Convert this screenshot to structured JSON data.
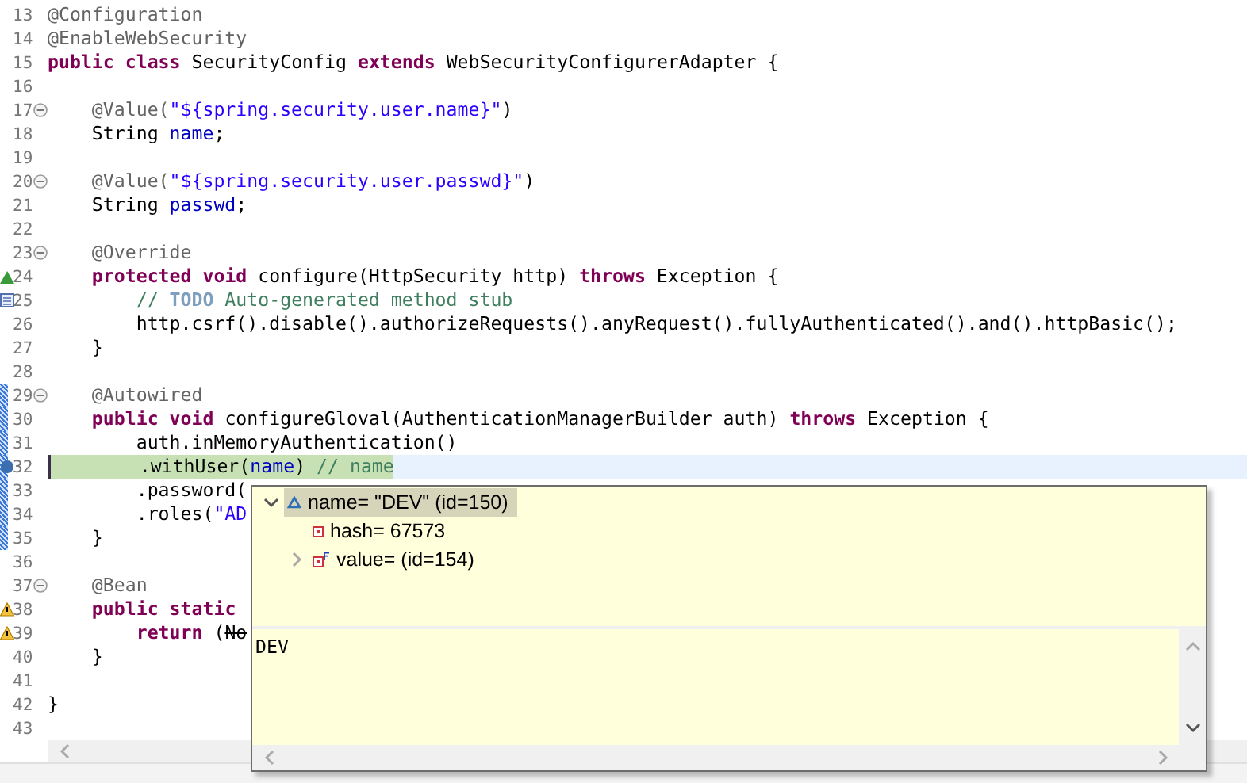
{
  "editor": {
    "lines": [
      {
        "number": "13",
        "kind": "plain",
        "fold": false,
        "in_frame": false,
        "current": false,
        "tokens": [
          {
            "kind": "annotation",
            "text": "@Configuration"
          }
        ]
      },
      {
        "number": "14",
        "kind": "plain",
        "fold": false,
        "in_frame": false,
        "current": false,
        "tokens": [
          {
            "kind": "annotation",
            "text": "@EnableWebSecurity"
          }
        ]
      },
      {
        "number": "15",
        "kind": "plain",
        "fold": false,
        "in_frame": false,
        "current": false,
        "tokens": [
          {
            "kind": "keyword",
            "text": "public"
          },
          {
            "kind": "keyword",
            "text": " class"
          },
          {
            "kind": "plain",
            "text": " SecurityConfig "
          },
          {
            "kind": "keyword",
            "text": "extends"
          },
          {
            "kind": "plain",
            "text": " WebSecurityConfigurerAdapter {"
          }
        ]
      },
      {
        "number": "16",
        "kind": "plain",
        "fold": false,
        "in_frame": false,
        "current": false
      },
      {
        "number": "17",
        "kind": "plain",
        "fold": true,
        "in_frame": false,
        "current": false,
        "tokens": [
          {
            "kind": "annotation",
            "text": "    @Value("
          },
          {
            "kind": "string",
            "text": "\"${spring.security.user.name}\""
          },
          {
            "kind": "plain",
            "text": ")"
          }
        ]
      },
      {
        "number": "18",
        "kind": "plain",
        "fold": false,
        "in_frame": false,
        "current": false,
        "tokens": [
          {
            "kind": "plain",
            "text": "    String "
          },
          {
            "kind": "field",
            "text": "name"
          },
          {
            "kind": "plain",
            "text": ";"
          }
        ]
      },
      {
        "number": "19",
        "kind": "plain",
        "fold": false,
        "in_frame": false,
        "current": false
      },
      {
        "number": "20",
        "kind": "plain",
        "fold": true,
        "in_frame": false,
        "current": false,
        "tokens": [
          {
            "kind": "annotation",
            "text": "    @Value("
          },
          {
            "kind": "string",
            "text": "\"${spring.security.user.passwd}\""
          },
          {
            "kind": "plain",
            "text": ")"
          }
        ]
      },
      {
        "number": "21",
        "kind": "plain",
        "fold": false,
        "in_frame": false,
        "current": false,
        "tokens": [
          {
            "kind": "plain",
            "text": "    String "
          },
          {
            "kind": "field",
            "text": "passwd"
          },
          {
            "kind": "plain",
            "text": ";"
          }
        ]
      },
      {
        "number": "22",
        "kind": "plain",
        "fold": false,
        "in_frame": false,
        "current": false
      },
      {
        "number": "23",
        "kind": "plain",
        "fold": true,
        "in_frame": false,
        "current": false,
        "tokens": [
          {
            "kind": "annotation",
            "text": "    @Override"
          }
        ]
      },
      {
        "number": "24",
        "kind": "override",
        "fold": false,
        "in_frame": false,
        "current": false,
        "tokens": [
          {
            "kind": "keyword",
            "text": "    protected"
          },
          {
            "kind": "keyword",
            "text": " void"
          },
          {
            "kind": "plain",
            "text": " configure(HttpSecurity http) "
          },
          {
            "kind": "keyword",
            "text": "throws"
          },
          {
            "kind": "plain",
            "text": " Exception {"
          }
        ]
      },
      {
        "number": "25",
        "kind": "task",
        "fold": false,
        "in_frame": false,
        "current": false,
        "tokens": [
          {
            "kind": "comment",
            "text": "        // "
          },
          {
            "kind": "task",
            "text": "TODO"
          },
          {
            "kind": "comment",
            "text": " Auto-generated method stub"
          }
        ]
      },
      {
        "number": "26",
        "kind": "plain",
        "fold": false,
        "in_frame": false,
        "current": false,
        "tokens": [
          {
            "kind": "plain",
            "text": "        http.csrf().disable().authorizeRequests().anyRequest().fullyAuthenticated().and().httpBasic();"
          }
        ]
      },
      {
        "number": "27",
        "kind": "plain",
        "fold": false,
        "in_frame": false,
        "current": false,
        "tokens": [
          {
            "kind": "plain",
            "text": "    }"
          }
        ]
      },
      {
        "number": "28",
        "kind": "plain",
        "fold": false,
        "in_frame": false,
        "current": false
      },
      {
        "number": "29",
        "kind": "plain",
        "fold": true,
        "in_frame": true,
        "current": false,
        "tokens": [
          {
            "kind": "annotation",
            "text": "    @Autowired"
          }
        ]
      },
      {
        "number": "30",
        "kind": "plain",
        "fold": false,
        "in_frame": true,
        "current": false,
        "tokens": [
          {
            "kind": "keyword",
            "text": "    public"
          },
          {
            "kind": "keyword",
            "text": " void"
          },
          {
            "kind": "plain",
            "text": " configureGloval(AuthenticationManagerBuilder auth) "
          },
          {
            "kind": "keyword",
            "text": "throws"
          },
          {
            "kind": "plain",
            "text": " Exception {"
          }
        ]
      },
      {
        "number": "31",
        "kind": "plain",
        "fold": false,
        "in_frame": true,
        "current": false,
        "tokens": [
          {
            "kind": "plain",
            "text": "        auth.inMemoryAuthentication()"
          }
        ]
      },
      {
        "number": "32",
        "kind": "breakpoint",
        "fold": false,
        "in_frame": true,
        "current": true,
        "tokens": [
          {
            "kind": "plain",
            "text": "        .withUser("
          },
          {
            "kind": "field",
            "text": "name"
          },
          {
            "kind": "plain",
            "text": ") "
          },
          {
            "kind": "comment",
            "text": "// name"
          }
        ]
      },
      {
        "number": "33",
        "kind": "plain",
        "fold": false,
        "in_frame": true,
        "current": false,
        "tokens": [
          {
            "kind": "plain",
            "text": "        .password("
          }
        ]
      },
      {
        "number": "34",
        "kind": "plain",
        "fold": false,
        "in_frame": true,
        "current": false,
        "tokens": [
          {
            "kind": "plain",
            "text": "        .roles("
          },
          {
            "kind": "string",
            "text": "\"AD"
          }
        ]
      },
      {
        "number": "35",
        "kind": "plain",
        "fold": false,
        "in_frame": true,
        "current": false,
        "tokens": [
          {
            "kind": "plain",
            "text": "    }"
          }
        ]
      },
      {
        "number": "36",
        "kind": "plain",
        "fold": false,
        "in_frame": false,
        "current": false
      },
      {
        "number": "37",
        "kind": "plain",
        "fold": true,
        "in_frame": false,
        "current": false,
        "tokens": [
          {
            "kind": "annotation",
            "text": "    @Bean"
          }
        ]
      },
      {
        "number": "38",
        "kind": "warning",
        "fold": false,
        "in_frame": false,
        "current": false,
        "tokens": [
          {
            "kind": "keyword",
            "text": "    public"
          },
          {
            "kind": "keyword",
            "text": " static"
          }
        ]
      },
      {
        "number": "39",
        "kind": "warning",
        "fold": false,
        "in_frame": false,
        "current": false,
        "tokens": [
          {
            "kind": "keyword",
            "text": "        return"
          },
          {
            "kind": "plain",
            "text": " ("
          },
          {
            "kind": "deprecated",
            "text": "No"
          }
        ]
      },
      {
        "number": "40",
        "kind": "plain",
        "fold": false,
        "in_frame": false,
        "current": false,
        "tokens": [
          {
            "kind": "plain",
            "text": "    }"
          }
        ]
      },
      {
        "number": "41",
        "kind": "plain",
        "fold": false,
        "in_frame": false,
        "current": false
      },
      {
        "number": "42",
        "kind": "plain",
        "fold": false,
        "in_frame": false,
        "current": false,
        "tokens": [
          {
            "kind": "plain",
            "text": "}"
          }
        ]
      },
      {
        "number": "43",
        "kind": "plain",
        "fold": false,
        "in_frame": false,
        "current": false
      }
    ]
  },
  "inspect_popup": {
    "tree": [
      {
        "label": "name= \"DEV\" (id=150)",
        "kind": "triangle",
        "expanded": true,
        "selected": true,
        "children": [
          {
            "label": "hash= 67573",
            "kind": "square",
            "selected": false
          },
          {
            "label": "value= (id=154)",
            "kind": "final",
            "expanded": false,
            "selected": false
          }
        ]
      }
    ],
    "detail": "DEV"
  }
}
